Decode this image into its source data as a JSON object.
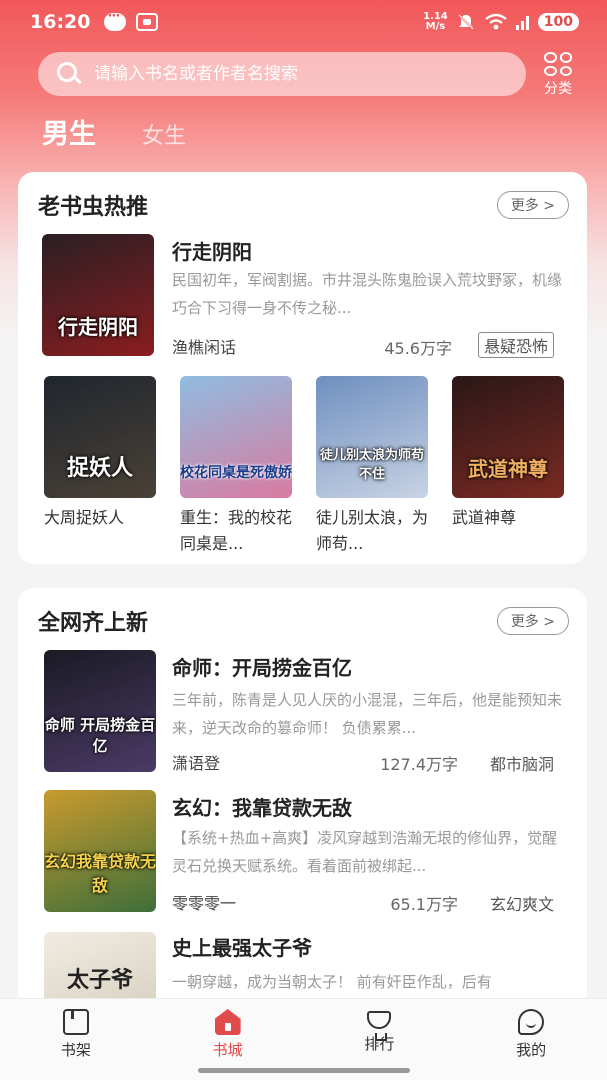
{
  "status_bar": {
    "time": "16:20",
    "net_speed_value": "1.14",
    "net_speed_unit": "M/s",
    "battery": "100"
  },
  "search": {
    "placeholder": "请输入书名或者作者名搜索"
  },
  "category": {
    "label": "分类"
  },
  "gender_tabs": {
    "male": "男生",
    "female": "女生"
  },
  "section_hot": {
    "title": "老书虫热推",
    "more_label": "更多 >",
    "featured": {
      "title": "行走阴阳",
      "desc": "民国初年，军阀割据。市井混头陈鬼脸误入荒坟野冢，机缘巧合下习得一身不传之秘...",
      "author": "渔樵闲话",
      "words": "45.6万字",
      "tag": "悬疑恐怖",
      "cover_text": "行走阴阳",
      "cover_colors": [
        "#2a1f24",
        "#8a1d1f"
      ]
    },
    "grid": [
      {
        "title": "大周捉妖人",
        "cover_text": "捉妖人",
        "cover_colors": [
          "#20262e",
          "#4a4137"
        ]
      },
      {
        "title": "重生：我的校花同桌是...",
        "cover_text": "校花同桌是死傲娇",
        "cover_colors": [
          "#8fbde0",
          "#d97aa0"
        ]
      },
      {
        "title": "徒儿别太浪，为师苟...",
        "cover_text": "徒儿别太浪为师苟不住",
        "cover_colors": [
          "#6f8fc0",
          "#c8d3e4"
        ]
      },
      {
        "title": "武道神尊",
        "cover_text": "武道神尊",
        "cover_colors": [
          "#2a1717",
          "#7a2a22"
        ]
      }
    ]
  },
  "section_new": {
    "title": "全网齐上新",
    "more_label": "更多 >",
    "books": [
      {
        "title": "命师：开局捞金百亿",
        "desc": "三年前，陈青是人见人厌的小混混，三年后，他是能预知未来，逆天改命的篡命师！ 负债累累...",
        "author": "潇语登",
        "words": "127.4万字",
        "tag": "都市脑洞",
        "cover_text": "命师 开局捞金百亿",
        "cover_colors": [
          "#1a1a24",
          "#4b3a66"
        ]
      },
      {
        "title": "玄幻：我靠贷款无敌",
        "desc": "【系统+热血+高爽】凌风穿越到浩瀚无垠的修仙界，觉醒灵石兑换天赋系统。看着面前被绑起...",
        "author": "零零零一",
        "words": "65.1万字",
        "tag": "玄幻爽文",
        "cover_text": "玄幻我靠贷款无敌",
        "cover_colors": [
          "#c99a2e",
          "#3e6f3a"
        ]
      },
      {
        "title": "史上最强太子爷",
        "desc": "一朝穿越，成为当朝太子！ 前有奸臣作乱，后有",
        "author": "",
        "words": "",
        "tag": "",
        "cover_text": "太子爷",
        "cover_colors": [
          "#f1ece2",
          "#d9d2c3"
        ]
      }
    ]
  },
  "bottom_nav": [
    {
      "label": "书架",
      "icon": "bookshelf-icon",
      "active": false
    },
    {
      "label": "书城",
      "icon": "home-icon",
      "active": true
    },
    {
      "label": "排行",
      "icon": "trophy-icon",
      "active": false
    },
    {
      "label": "我的",
      "icon": "profile-icon",
      "active": false
    }
  ],
  "colors": {
    "accent": "#e24b4b",
    "header_top": "#f2585a"
  }
}
